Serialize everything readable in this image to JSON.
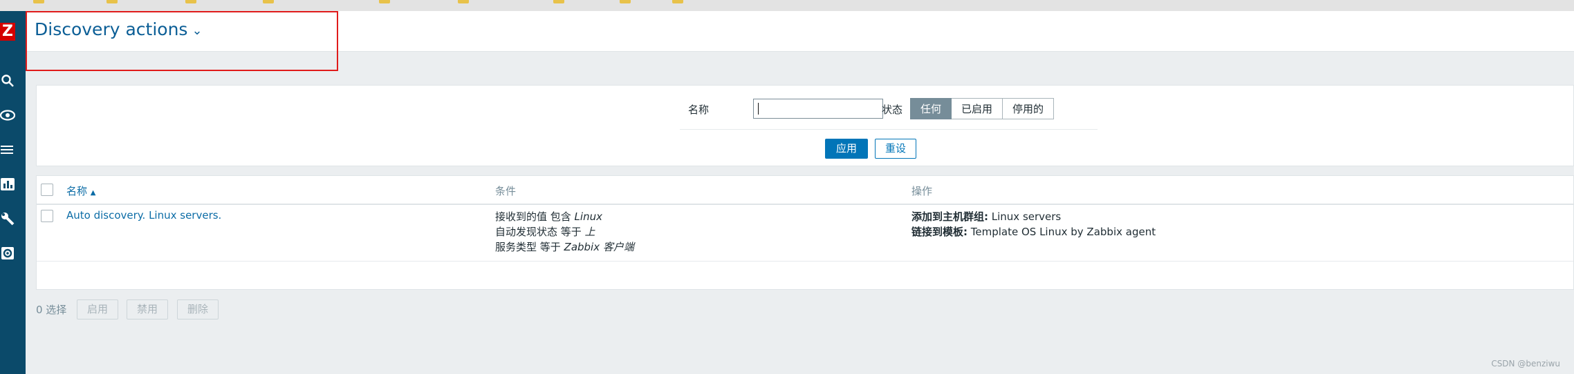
{
  "header": {
    "title": "Discovery actions",
    "logo": "Z"
  },
  "sidebar": {
    "icons": [
      "search-icon",
      "eye-icon",
      "list-icon",
      "bar-chart-icon",
      "wrench-icon",
      "gear-icon"
    ]
  },
  "filter": {
    "name_label": "名称",
    "name_value": "",
    "status_label": "状态",
    "status_options": [
      "任何",
      "已启用",
      "停用的"
    ],
    "status_selected": "任何",
    "apply_label": "应用",
    "reset_label": "重设"
  },
  "table": {
    "columns": [
      "名称",
      "条件",
      "操作"
    ],
    "sort_indicator": "▲",
    "rows": [
      {
        "name": "Auto discovery. Linux servers.",
        "conditions": [
          {
            "text": "接收到的值 包含 ",
            "value": "Linux"
          },
          {
            "text": "自动发现状态 等于 ",
            "value": "上"
          },
          {
            "text": "服务类型 等于 ",
            "value": "Zabbix 客户端"
          }
        ],
        "operations": [
          {
            "label": "添加到主机群组:",
            "value": " Linux servers"
          },
          {
            "label": "链接到模板:",
            "value": " Template OS Linux by Zabbix agent"
          }
        ]
      }
    ]
  },
  "footer": {
    "selected_text": "0 选择",
    "buttons": [
      "启用",
      "禁用",
      "删除"
    ]
  },
  "watermark": "CSDN @benziwu",
  "colors": {
    "sidebar": "#0b4a6a",
    "link": "#0b6ca6",
    "primary": "#0275b8",
    "highlight_box": "#e01b1b"
  }
}
